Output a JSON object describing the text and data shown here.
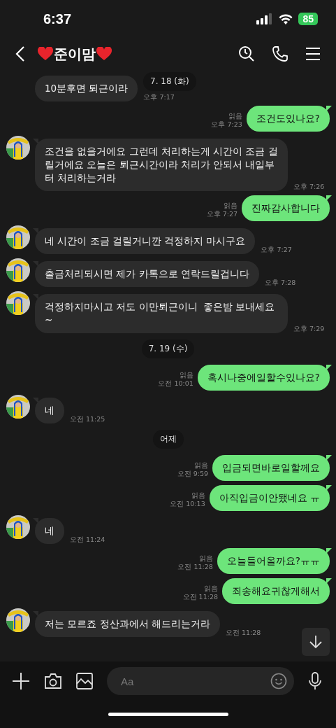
{
  "status_bar": {
    "time": "6:37",
    "battery": "85"
  },
  "header": {
    "title": "준이맘"
  },
  "sticky_date": "7. 18 (화)",
  "messages": [
    {
      "kind": "received",
      "text": "10분후면 퇴근이라",
      "time": "오후 7:17",
      "avatar": false
    },
    {
      "kind": "sent",
      "text": "조건도있나요?",
      "time": "오후 7:23",
      "read_label": "읽음"
    },
    {
      "kind": "received",
      "text": "조건을 없을거에요 그런데 처리하는게 시간이 조금 걸릴거에요 오늘은 퇴근시간이라 처리가 안되서 내일부터 처리하는거라",
      "time": "오후 7:26",
      "avatar": true
    },
    {
      "kind": "sent",
      "text": "진짜감사합니다",
      "time": "오후 7:27",
      "read_label": "읽음"
    },
    {
      "kind": "received",
      "text": "네 시간이 조금 걸릴거니깐 걱정하지 마시구요",
      "time": "오후 7:27",
      "avatar": true
    },
    {
      "kind": "received",
      "text": "출금처리되시면 제가 카톡으로 연락드릴겁니다",
      "time": "오후 7:28",
      "avatar": true
    },
    {
      "kind": "received",
      "text": "걱정하지마시고 저도 이만퇴근이니  좋은밤 보내세요~",
      "time": "오후 7:29",
      "avatar": true
    },
    {
      "kind": "date",
      "text": "7. 19 (수)"
    },
    {
      "kind": "sent",
      "text": "혹시나중에일할수있나요?",
      "time": "오전 10:01",
      "read_label": "읽음"
    },
    {
      "kind": "received",
      "text": "네",
      "time": "오전 11:25",
      "avatar": true
    },
    {
      "kind": "date",
      "text": "어제"
    },
    {
      "kind": "sent",
      "text": "입금되면바로일할께요",
      "time": "오전 9:59",
      "read_label": "읽음"
    },
    {
      "kind": "sent",
      "text": "아직입금이안됐네요 ㅠ",
      "time": "오전 10:13",
      "read_label": "읽음"
    },
    {
      "kind": "received",
      "text": "네",
      "time": "오전 11:24",
      "avatar": true
    },
    {
      "kind": "sent",
      "text": "오늘들어올까요?ㅠㅠ",
      "time": "오전 11:28",
      "read_label": "읽음"
    },
    {
      "kind": "sent",
      "text": "죄송해요귀찮게해서",
      "time": "오전 11:28",
      "read_label": "읽음"
    },
    {
      "kind": "received",
      "text": "저는 모르죠 정산과에서 해드리는거라",
      "time": "오전 11:28",
      "avatar": true
    }
  ],
  "input": {
    "placeholder": "Aa"
  }
}
